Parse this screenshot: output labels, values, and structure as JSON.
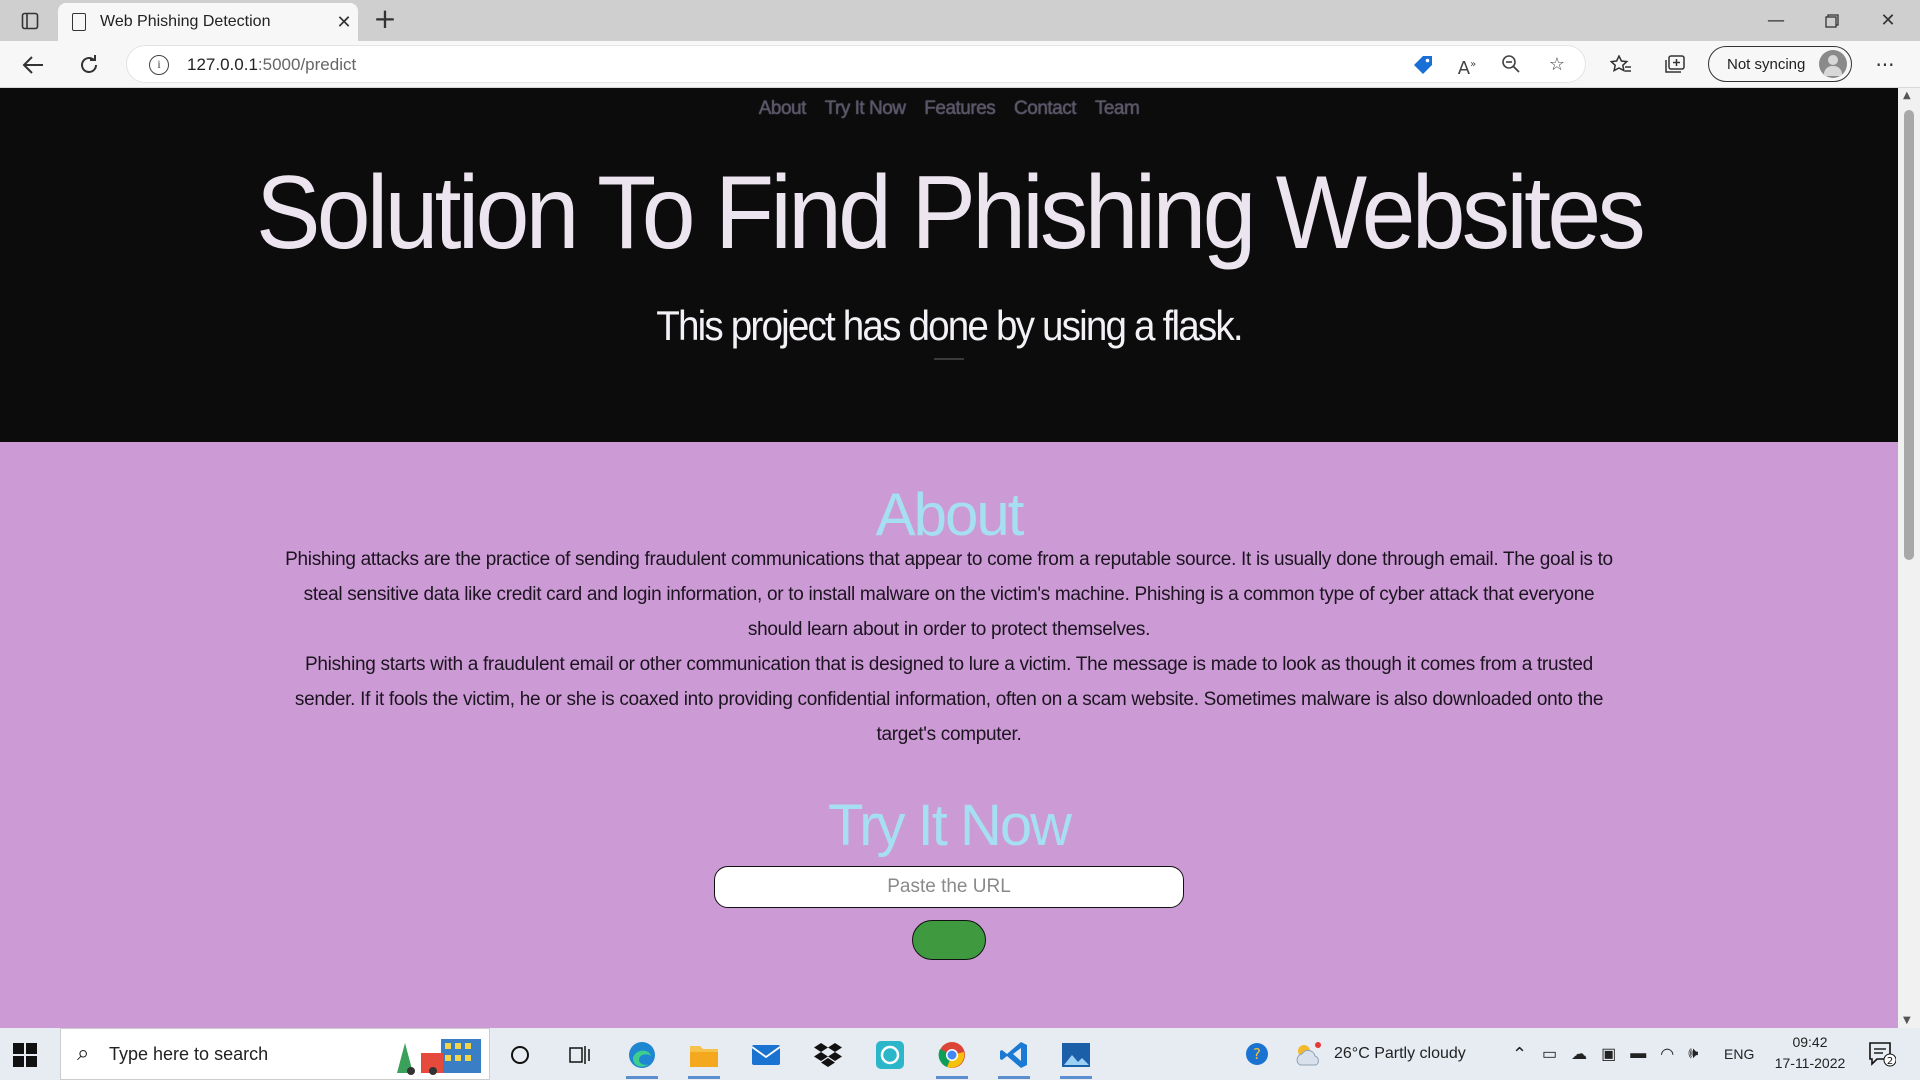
{
  "browser": {
    "tab_title": "Web Phishing Detection",
    "url_host": "127.0.0.1",
    "url_rest": ":5000/predict",
    "sync_label": "Not syncing"
  },
  "page": {
    "nav": [
      "About",
      "Try It Now",
      "Features",
      "Contact",
      "Team"
    ],
    "hero_title": "Solution To Find Phishing Websites",
    "hero_subtitle": "This project has done by using a flask.",
    "about_heading": "About",
    "about_p1": "Phishing attacks are the practice of sending fraudulent communications that appear to come from a reputable source. It is usually done through email. The goal is to steal sensitive data like credit card and login information, or to install malware on the victim's machine. Phishing is a common type of cyber attack that everyone should learn about in order to protect themselves.",
    "about_p2": "Phishing starts with a fraudulent email or other communication that is designed to lure a victim. The message is made to look as though it comes from a trusted sender. If it fools the victim, he or she is coaxed into providing confidential information, often on a scam website. Sometimes malware is also downloaded onto the target's computer.",
    "try_heading": "Try It Now",
    "url_placeholder": "Paste the URL",
    "colors": {
      "hero_bg": "#0c0c0d",
      "section_bg": "#cc9ad4",
      "heading": "#a6dff1",
      "button": "#3f9a3f"
    }
  },
  "taskbar": {
    "search_placeholder": "Type here to search",
    "weather": "26°C  Partly cloudy",
    "lang": "ENG",
    "time": "09:42",
    "date": "17-11-2022",
    "notif_count": "2",
    "apps": [
      "cortana-icon",
      "task-view-icon",
      "edge-icon",
      "file-explorer-icon",
      "mail-icon",
      "dropbox-icon",
      "signal-icon",
      "chrome-icon",
      "vscode-icon",
      "photos-icon"
    ]
  }
}
